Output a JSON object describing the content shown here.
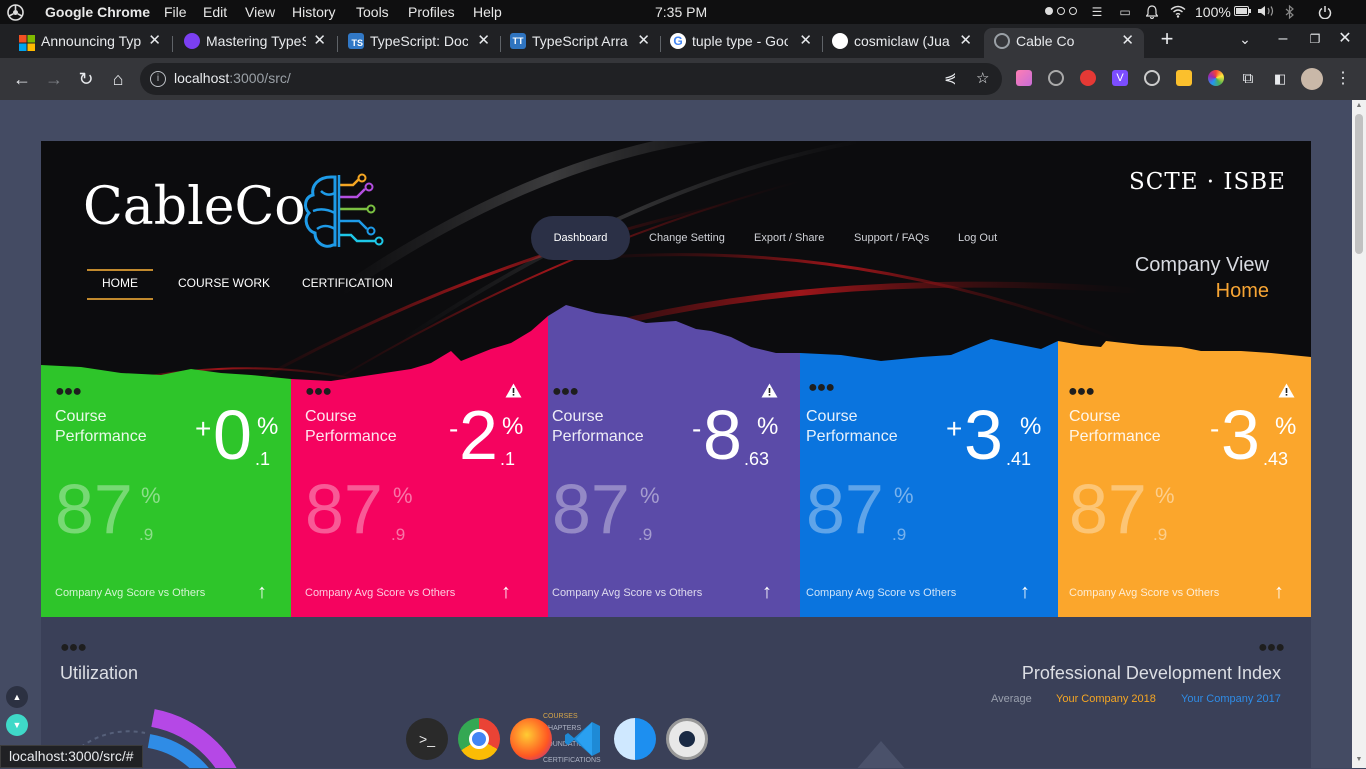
{
  "os_bar": {
    "app_name": "Google Chrome",
    "menus": [
      "File",
      "Edit",
      "View",
      "History",
      "Tools",
      "Profiles",
      "Help"
    ],
    "clock": "7:35 PM",
    "battery": "100%"
  },
  "tabs": [
    {
      "title": "Announcing TypeScript",
      "favicon_color": "#f25022"
    },
    {
      "title": "Mastering TypeScript",
      "favicon_color": "#7b3ff2"
    },
    {
      "title": "TypeScript: Documentation",
      "favicon_color": "#3178c6"
    },
    {
      "title": "TypeScript Array",
      "favicon_color": "#2f74c0"
    },
    {
      "title": "tuple type - Google",
      "favicon_color": "#ffffff"
    },
    {
      "title": "cosmiclaw (Juan)",
      "favicon_color": "#ffffff"
    },
    {
      "title": "Cable Co",
      "favicon_color": "#9aa0a6"
    }
  ],
  "toolbar": {
    "url_host": "localhost",
    "url_rest": ":3000/src/"
  },
  "hero": {
    "brand": "CableCo",
    "nav": [
      "HOME",
      "COURSE WORK",
      "CERTIFICATION"
    ],
    "top_links": [
      "Dashboard",
      "Change Setting",
      "Export / Share",
      "Support / FAQs",
      "Log Out"
    ],
    "partner": "SCTE · ISBE",
    "view_title": "Company View",
    "view_sub": "Home"
  },
  "cards": [
    {
      "label": "Course Performance",
      "sign": "+",
      "value": "0",
      "pct": "%",
      "dec": ".1",
      "score": "87",
      "score_pct": "%",
      "score_dec": ".9",
      "footer": "Company Avg Score vs Others",
      "color": "#2ec52a",
      "warning": false
    },
    {
      "label": "Course Performance",
      "sign": "-",
      "value": "2",
      "pct": "%",
      "dec": ".1",
      "score": "87",
      "score_pct": "%",
      "score_dec": ".9",
      "footer": "Company Avg Score vs Others",
      "color": "#f5035f",
      "warning": true
    },
    {
      "label": "Course Performance",
      "sign": "-",
      "value": "8",
      "pct": "%",
      "dec": ".63",
      "score": "87",
      "score_pct": "%",
      "score_dec": ".9",
      "footer": "Company Avg Score vs Others",
      "color": "#5b4ba8",
      "warning": true
    },
    {
      "label": "Course Performance",
      "sign": "+",
      "value": "3",
      "pct": "%",
      "dec": ".41",
      "score": "87",
      "score_pct": "%",
      "score_dec": ".9",
      "footer": "Company Avg Score vs Others",
      "color": "#0a74de",
      "warning": false
    },
    {
      "label": "Course Performance",
      "sign": "-",
      "value": "3",
      "pct": "%",
      "dec": ".43",
      "score": "87",
      "score_pct": "%",
      "score_dec": ".9",
      "footer": "Company Avg Score vs Others",
      "color": "#fba62c",
      "warning": true
    }
  ],
  "lower": {
    "utilization_title": "Utilization",
    "pdi_title": "Professional Development Index",
    "legend": [
      {
        "label": "Average",
        "color": "#9aa0ae"
      },
      {
        "label": "Your Company 2018",
        "color": "#f5a623"
      },
      {
        "label": "Your Company 2017",
        "color": "#2f8ce6"
      }
    ]
  },
  "hover_menu": [
    "COURSES",
    "CHAPTERS",
    "FOUNDATION",
    "CERTIFICATIONS"
  ],
  "status_url": "localhost:3000/src/#"
}
